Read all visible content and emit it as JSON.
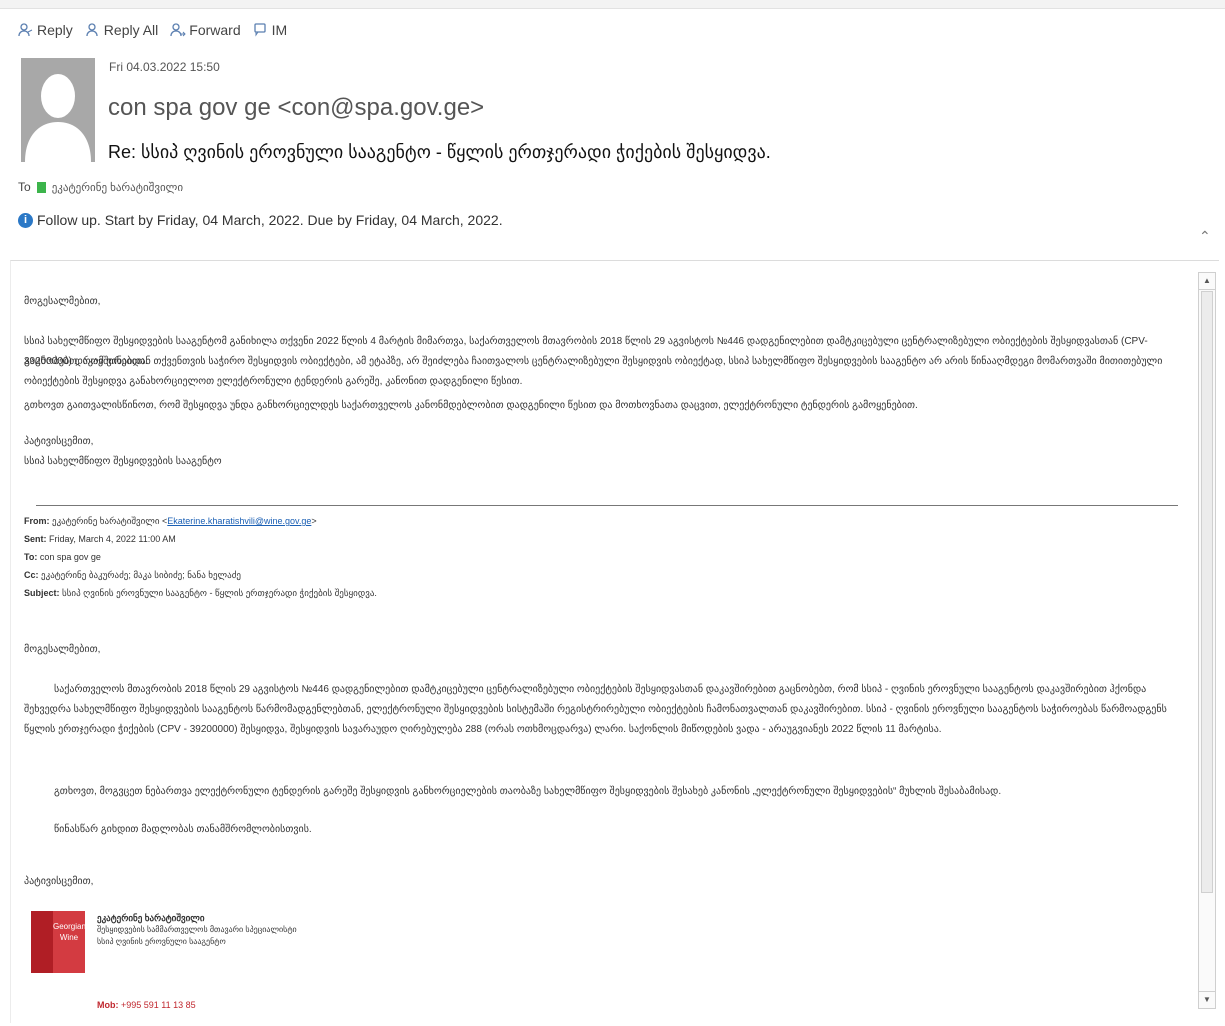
{
  "toolbar": {
    "reply": "Reply",
    "reply_all": "Reply All",
    "forward": "Forward",
    "im": "IM"
  },
  "header": {
    "date": "Fri 04.03.2022 15:50",
    "sender": "con spa gov ge <con@spa.gov.ge>",
    "subject": "Re: სსიპ ღვინის ეროვნული სააგენტო - წყლის ერთჯერადი ჭიქების შესყიდვა.",
    "to_label": "To",
    "to_name": "ეკატერინე ხარატიშვილი",
    "follow_up": "Follow up. Start by Friday, 04 March, 2022. Due by Friday, 04 March, 2022."
  },
  "reply_body": {
    "greeting": "მოგესალმებით,",
    "p1": "სსიპ სახელმწიფო შესყიდვების სააგენტომ განიხილა თქვენი 2022 წლის 4 მარტის მიმართვა, საქართველოს მთავრობის 2018 წლის 29 აგვისტოს №446 დადგენილებით დამტკიცებული ცენტრალიზებული ობიექტების შესყიდვასთან (CPV-39200000) დაკავშირებით.",
    "p2": "გაცნობებთ, რომ ვინაიდან თქვენთვის საჭირო შესყიდვის ობიექტები, ამ ეტაპზე, არ შეიძლება ჩაითვალოს ცენტრალიზებული შესყიდვის ობიექტად, სსიპ სახელმწიფო შესყიდვების სააგენტო არ არის წინააღმდეგი მომართვაში მითითებული ობიექტების შესყიდვა განახორციელოთ ელექტრონული ტენდერის გარეშე, კანონით დადგენილი წესით.",
    "p3": "გთხოვთ გაითვალისწინოთ, რომ შესყიდვა უნდა განხორციელდეს საქართველოს კანონმდებლობით დადგენილი წესით და მოთხოვნათა დაცვით, ელექტრონული ტენდერის გამოყენებით.",
    "closing": "პატივისცემით,",
    "signature": "სსიპ სახელმწიფო შესყიდვების სააგენტო"
  },
  "original": {
    "from_label": "From:",
    "from_name": "ეკატერინე ხარატიშვილი",
    "from_email": "Ekaterine.kharatishvili@wine.gov.ge",
    "sent_label": "Sent:",
    "sent": "Friday, March 4, 2022 11:00 AM",
    "to_label": "To:",
    "to": "con spa gov ge",
    "cc_label": "Cc:",
    "cc": "ეკატერინე ბაკურაძე; მაკა სიბიძე; ნანა ხელაძე",
    "subject_label": "Subject:",
    "subject": "სსიპ ღვინის ეროვნული სააგენტო - წყლის ერთჯერადი ჭიქების შესყიდვა.",
    "greeting": "მოგესალმებით,",
    "p1": "საქართველოს მთავრობის 2018 წლის 29 აგვისტოს №446 დადგენილებით დამტკიცებული ცენტრალიზებული ობიექტების შესყიდვასთან დაკავშირებით გაცნობებთ, რომ სსიპ - ღვინის ეროვნული სააგენტოს დაკავშირებით ჰქონდა შეხვედრა სახელმწიფო შესყიდვების სააგენტოს წარმომადგენლებთან, ელექტრონული შესყიდვების სისტემაში რეგისტრირებული ობიექტების ჩამონათვალთან დაკავშირებით. სსიპ - ღვინის ეროვნული სააგენტოს საჭიროებას წარმოადგენს წყლის ერთჯერადი ჭიქების (CPV - 39200000) შესყიდვა, შესყიდვის სავარაუდო ღირებულება 288 (ორას ოთხმოცდარვა) ლარი. საქონლის მიწოდების ვადა - არაუგვიანეს 2022 წლის 11 მარტისა.",
    "p2": "გთხოვთ, მოგვცეთ ნებართვა ელექტრონული ტენდერის გარეშე შესყიდვის განხორციელების თაობაზე სახელმწიფო შესყიდვების შესახებ კანონის „ელექტრონული შესყიდვების“ მუხლის შესაბამისად.",
    "p3": "წინასწარ გიხდით მადლობას თანამშრომლობისთვის.",
    "closing": "პატივისცემით,",
    "sig_name": "ეკატერინე ხარატიშვილი",
    "sig_role": "შესყიდვების სამმართველოს მთავარი სპეციალისტი",
    "sig_org": "სსიპ ღვინის ეროვნული სააგენტო",
    "logo_text": "Georgian Wine",
    "mob_label": "Mob:",
    "mob": "+995 591 11 13 85"
  },
  "colors": {
    "accent": "#2b78c6",
    "logo": "#c0282f"
  }
}
